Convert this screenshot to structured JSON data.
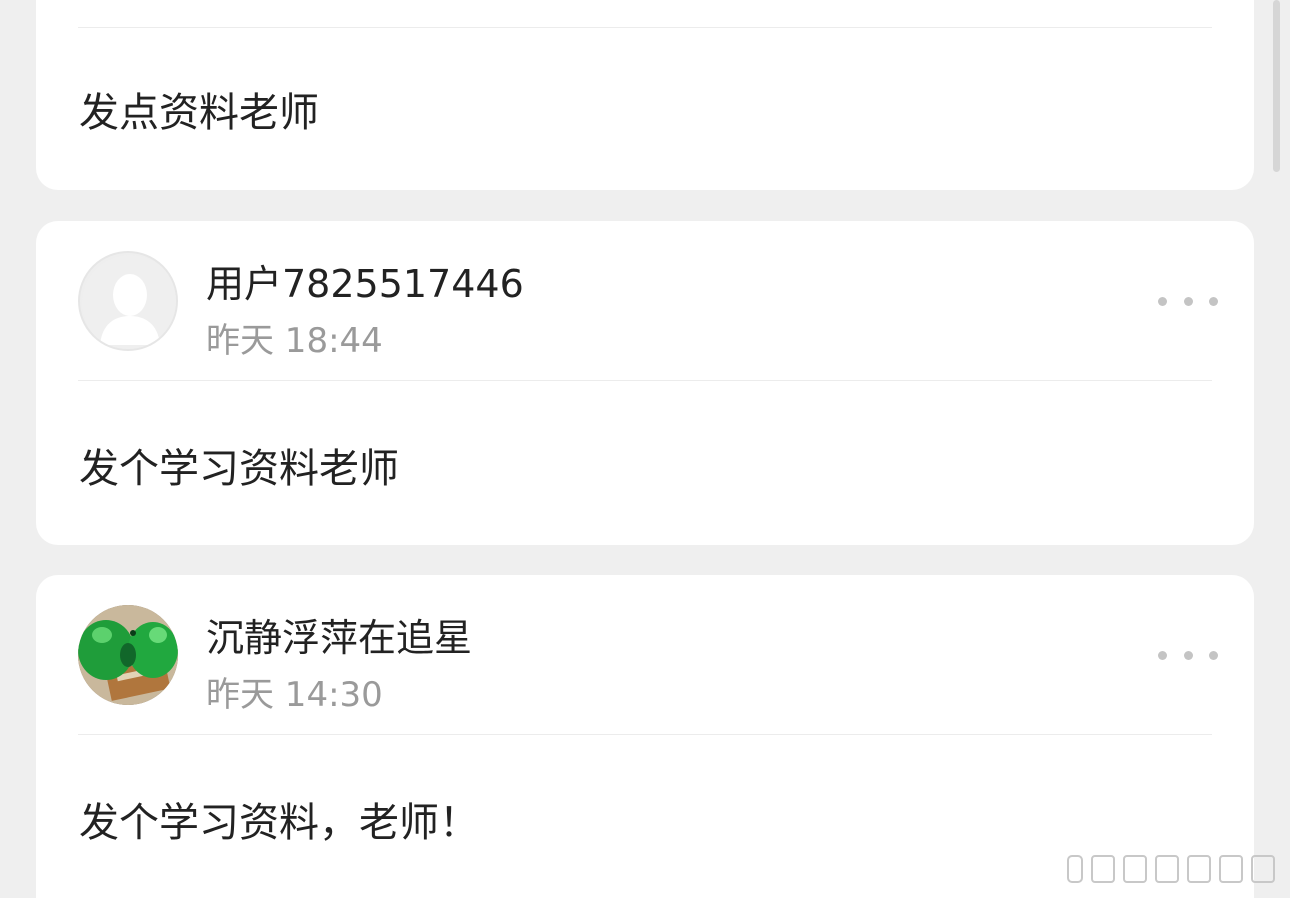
{
  "comments": [
    {
      "text": "发点资料老师"
    },
    {
      "username": "用户7825517446",
      "timestamp": "昨天 18:44",
      "text": "发个学习资料老师",
      "avatar": "default-avatar-icon"
    },
    {
      "username": "沉静浮萍在追星",
      "timestamp": "昨天 14:30",
      "text": "发个学习资料，老师！",
      "avatar": "green-toy-photo"
    }
  ],
  "more_icon": "more-dots-icon",
  "colors": {
    "background": "#efefef",
    "card": "#ffffff",
    "primary_text": "#222222",
    "secondary_text": "#9a9a9a",
    "divider": "#ececec"
  }
}
